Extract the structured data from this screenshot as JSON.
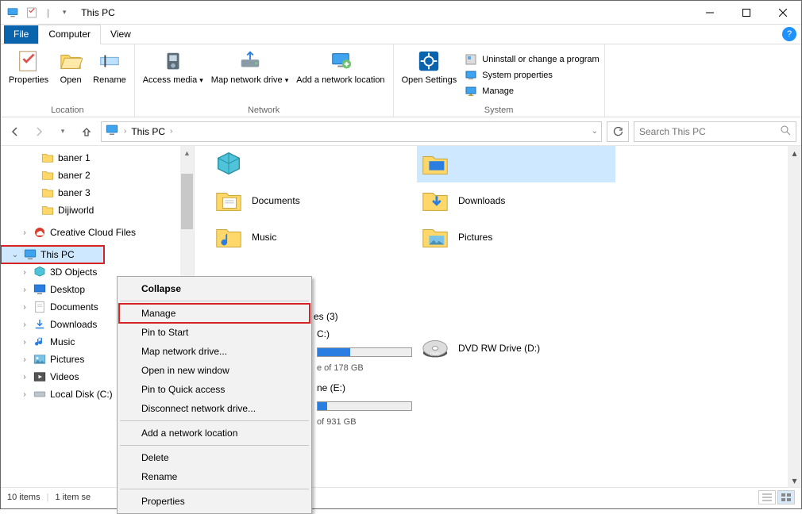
{
  "window_title": "This PC",
  "tabs": {
    "file": "File",
    "computer": "Computer",
    "view": "View"
  },
  "ribbon": {
    "location": {
      "label": "Location",
      "properties": "Properties",
      "open": "Open",
      "rename": "Rename"
    },
    "network": {
      "label": "Network",
      "access_media": "Access media",
      "map_drive": "Map network drive",
      "add_loc": "Add a network location"
    },
    "system": {
      "label": "System",
      "open_settings": "Open Settings",
      "uninstall": "Uninstall or change a program",
      "sys_props": "System properties",
      "manage": "Manage"
    }
  },
  "breadcrumb": "This PC",
  "search_placeholder": "Search This PC",
  "tree": {
    "baner1": "baner 1",
    "baner2": "baner 2",
    "baner3": "baner 3",
    "dijiworld": "Dijiworld",
    "creative": "Creative Cloud Files",
    "thispc": "This PC",
    "objects3d": "3D Objects",
    "desktop": "Desktop",
    "documents": "Documents",
    "downloads": "Downloads",
    "music": "Music",
    "pictures": "Pictures",
    "videos": "Videos",
    "localdisk": "Local Disk (C:)"
  },
  "folders": {
    "documents": "Documents",
    "downloads": "Downloads",
    "music": "Music",
    "pictures": "Pictures"
  },
  "drives": {
    "section": "es (3)",
    "c_label": "C:)",
    "c_free": "e of 178 GB",
    "e_label": "ne (E:)",
    "e_free": "of 931 GB",
    "dvd": "DVD RW Drive (D:)"
  },
  "status": {
    "items": "10 items",
    "selected": "1 item se"
  },
  "context_menu": {
    "collapse": "Collapse",
    "manage": "Manage",
    "pin_start": "Pin to Start",
    "map_drive": "Map network drive...",
    "open_new": "Open in new window",
    "pin_quick": "Pin to Quick access",
    "disconnect": "Disconnect network drive...",
    "add_loc": "Add a network location",
    "delete": "Delete",
    "rename": "Rename",
    "properties": "Properties"
  }
}
